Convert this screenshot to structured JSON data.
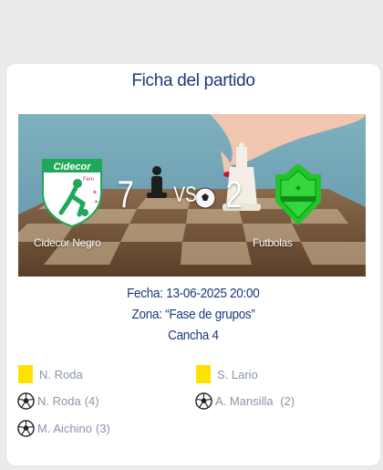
{
  "match": {
    "title": "Ficha del partido",
    "home": {
      "name": "Cidecor Negro",
      "score": "7",
      "logo_text": "Cidecor",
      "logo_sub": "Fem"
    },
    "away": {
      "name": "Futbolas",
      "score": "2"
    },
    "vs": "VS",
    "date_line": "Fecha: 13-06-2025 20:00",
    "zone_line": "Zona: “Fase de grupos”",
    "field_line": "Cancha 4"
  },
  "events": {
    "home": [
      {
        "type": "yellow-card",
        "player": "N. Roda",
        "count": ""
      },
      {
        "type": "goal",
        "player": "N. Roda",
        "count": "(4)"
      },
      {
        "type": "goal",
        "player": "M. Aichino",
        "count": "(3)"
      }
    ],
    "away": [
      {
        "type": "yellow-card",
        "player": "S. Lario",
        "count": ""
      },
      {
        "type": "goal",
        "player": "A. Mansilla ",
        "count": "(2)"
      }
    ]
  },
  "colors": {
    "title": "#1b3a7a",
    "event_text": "#8a96a8",
    "yellow_card": "#ffe100",
    "away_logo": "#22c42c",
    "home_logo": "#1fa85a"
  },
  "icons": [
    "yellow-card-icon",
    "soccer-ball-icon",
    "home-team-logo",
    "away-team-logo"
  ]
}
